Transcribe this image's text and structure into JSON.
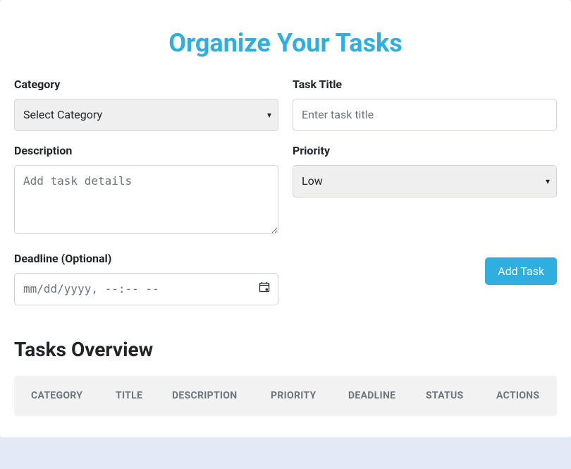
{
  "page": {
    "title": "Organize Your Tasks"
  },
  "form": {
    "category": {
      "label": "Category",
      "selected": "Select Category"
    },
    "taskTitle": {
      "label": "Task Title",
      "placeholder": "Enter task title",
      "value": ""
    },
    "description": {
      "label": "Description",
      "placeholder": "Add task details",
      "value": ""
    },
    "priority": {
      "label": "Priority",
      "selected": "Low"
    },
    "deadline": {
      "label": "Deadline (Optional)",
      "placeholder": "mm/dd/yyyy, --:-- --",
      "value": ""
    },
    "submit": {
      "label": "Add Task"
    }
  },
  "overview": {
    "title": "Tasks Overview",
    "columns": {
      "category": "CATEGORY",
      "title": "TITLE",
      "description": "DESCRIPTION",
      "priority": "PRIORITY",
      "deadline": "DEADLINE",
      "status": "STATUS",
      "actions": "ACTIONS"
    }
  }
}
